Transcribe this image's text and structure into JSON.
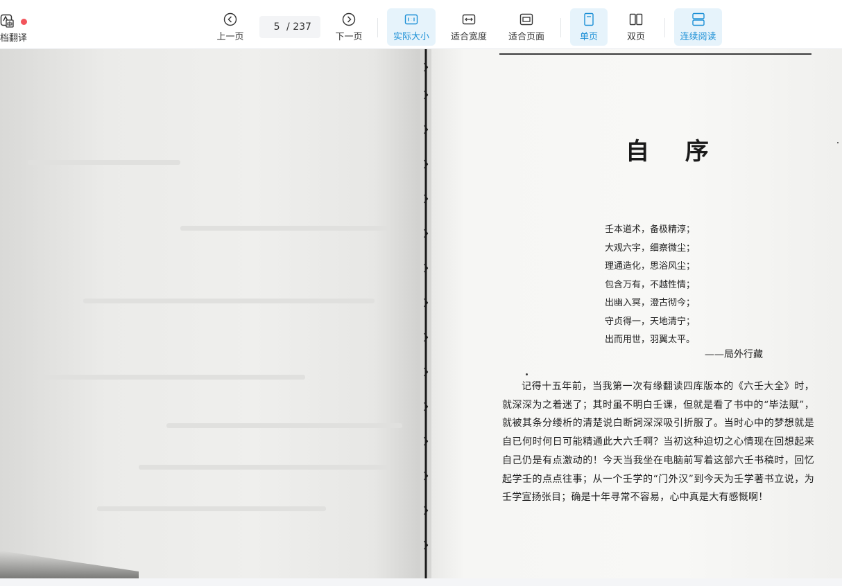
{
  "toolbar": {
    "translate_label": "档翻译",
    "prev_label": "上一页",
    "page_current": "5",
    "page_total": "/ 237",
    "next_label": "下一页",
    "actual_size_label": "实际大小",
    "fit_width_label": "适合宽度",
    "fit_page_label": "适合页面",
    "single_page_label": "单页",
    "double_page_label": "双页",
    "continuous_label": "连续阅读",
    "accent_color": "#1a8fd6",
    "active_bg_color": "#e6f3fb",
    "notification_dot_color": "#f2545b",
    "active_modes": [
      "actual-size",
      "single-page",
      "continuous"
    ]
  },
  "document": {
    "title": "自 序",
    "poem_lines": [
      "壬本道术，备极精淳；",
      "大观六宇，细察微尘；",
      "理通造化，思浴风尘；",
      "包含万有，不越性情；",
      "出幽入冥，澄古彻今；",
      "守贞得一，天地清宁；",
      "出而用世，羽翼太平。"
    ],
    "poem_signature": "——局外行藏",
    "paragraph": "记得十五年前，当我第一次有缘翻读四库版本的《六壬大全》时，就深深为之着迷了；其时虽不明白壬课，但就是看了书中的“毕法赋”，就被其条分缕析的清楚说白断詞深深吸引折服了。当时心中的梦想就是自已何时何日可能精通此大六壬啊？当初这种迫切之心情现在回想起来自己仍是有点激动的！今天当我坐在电脑前写着这部六壬书稿时，回忆起学壬的点点往事；从一个壬学的“门外汉”到今天为壬学著书立说，为壬学宣扬张目；确是十年寻常不容易，心中真是大有感慨啊！"
  }
}
